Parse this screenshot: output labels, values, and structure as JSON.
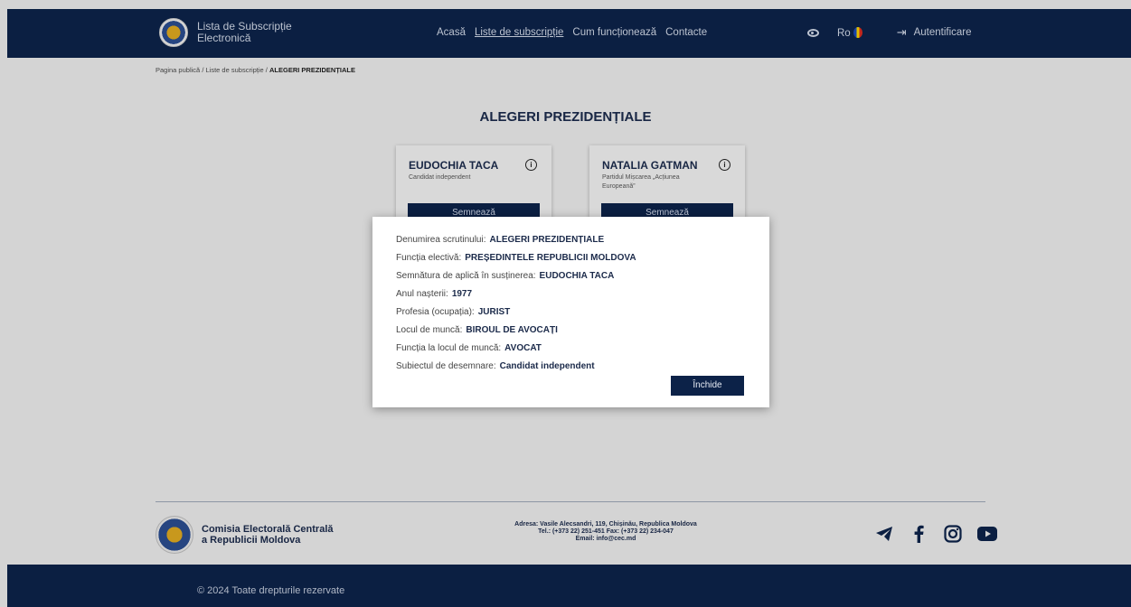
{
  "header": {
    "brand_title": "Lista de Subscripție Electronică",
    "nav": [
      "Acasă",
      "Liste de subscripție",
      "Cum funcționează",
      "Contacte"
    ],
    "active_nav": "Liste de subscripție",
    "lang": "Ro",
    "login": "Autentificare"
  },
  "breadcrumb": {
    "home": "Pagina publică",
    "sep": "/",
    "lists": "Liste de subscripție",
    "current": "ALEGERI PREZIDENȚIALE"
  },
  "main": {
    "title": "ALEGERI PREZIDENȚIALE",
    "cards": [
      {
        "name": "EUDOCHIA TACA",
        "party": "Candidat independent",
        "button": "Semnează"
      },
      {
        "name": "NATALIA GATMAN",
        "party": "Partidul Mișcarea „Acțiunea Europeană”",
        "button": "Semnează"
      }
    ]
  },
  "modal": {
    "rows": [
      {
        "label": "Denumirea scrutinului:",
        "value": "ALEGERI PREZIDENȚIALE"
      },
      {
        "label": "Funcția electivă:",
        "value": "PREȘEDINTELE REPUBLICII MOLDOVA"
      },
      {
        "label": "Semnătura de aplică în susținerea:",
        "value": "EUDOCHIA TACA"
      },
      {
        "label": "Anul nașterii:",
        "value": "1977"
      },
      {
        "label": "Profesia (ocupația):",
        "value": "JURIST"
      },
      {
        "label": "Locul de muncă:",
        "value": "BIROUL DE AVOCAȚI"
      },
      {
        "label": "Funcția la locul de muncă:",
        "value": "AVOCAT"
      },
      {
        "label": "Subiectul de desemnare:",
        "value": "Candidat independent"
      }
    ],
    "close": "Închide"
  },
  "footer": {
    "org_line1": "Comisia Electorală Centrală",
    "org_line2": "a Republicii Moldova",
    "address": "Adresa: Vasile Alecsandri, 119, Chișinău, Republica Moldova",
    "phone": "Tel.: (+373 22) 251-451 Fax: (+373 22) 234-047",
    "email": "Email: info@cec.md",
    "copyright": "© 2024 Toate drepturile rezervate",
    "socials": [
      "telegram-icon",
      "facebook-icon",
      "instagram-icon",
      "youtube-icon"
    ]
  },
  "colors": {
    "navy": "#0c2248",
    "background": "#e6e6e6"
  }
}
